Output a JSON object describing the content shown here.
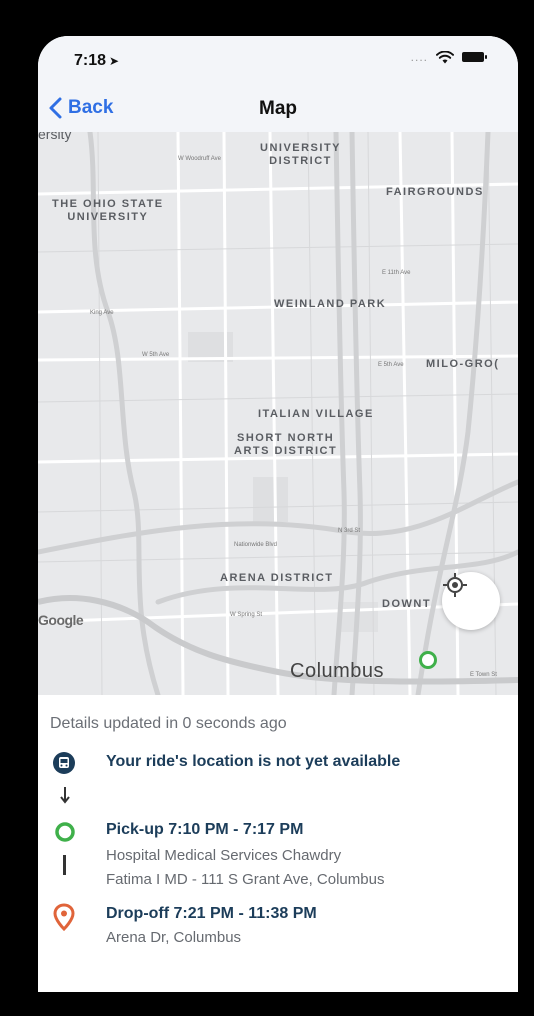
{
  "status_bar": {
    "time": "7:18",
    "location_icon": "location-arrow-icon",
    "signal_dots": "....",
    "wifi_icon": "wifi-icon",
    "battery_icon": "battery-icon"
  },
  "nav": {
    "back_label": "Back",
    "title": "Map"
  },
  "map": {
    "labels": {
      "ersity": "ersity",
      "university_district": "UNIVERSITY\nDISTRICT",
      "ohio_state": "THE OHIO STATE\nUNIVERSITY",
      "fairgrounds": "FAIRGROUNDS",
      "weinland_park": "WEINLAND PARK",
      "milo_grove": "MILO-GRO(",
      "italian_village": "ITALIAN VILLAGE",
      "short_north": "SHORT NORTH\nARTS DISTRICT",
      "arena_district": "ARENA DISTRICT",
      "downtown": "DOWNT",
      "columbus": "Columbus",
      "google": "Google"
    },
    "streets": {
      "w_woodruff": "W Woodruff Ave",
      "e_11th": "E 11th Ave",
      "king": "King Ave",
      "w_5th": "W 5th Ave",
      "e_5th": "E 5th Ave",
      "w_spring": "W Spring St",
      "nationwide": "Nationwide Blvd",
      "e_town": "E Town St",
      "n_3rd": "N 3rd St"
    },
    "recenter_icon": "crosshair-icon",
    "pickup_marker_color": "#3fb04a"
  },
  "details": {
    "updated_text": "Details updated in 0 seconds ago",
    "ride_status": "Your ride's location is not yet available",
    "pickup": {
      "title": "Pick-up 7:10 PM - 7:17 PM",
      "address_line1": "Hospital Medical Services Chawdry",
      "address_line2": "Fatima I MD - 111 S Grant Ave, Columbus",
      "color": "#3fb04a"
    },
    "dropoff": {
      "title": "Drop-off 7:21 PM - 11:38 PM",
      "address": "Arena Dr, Columbus",
      "color": "#e0643a"
    },
    "accent": "#1c3d5a"
  }
}
